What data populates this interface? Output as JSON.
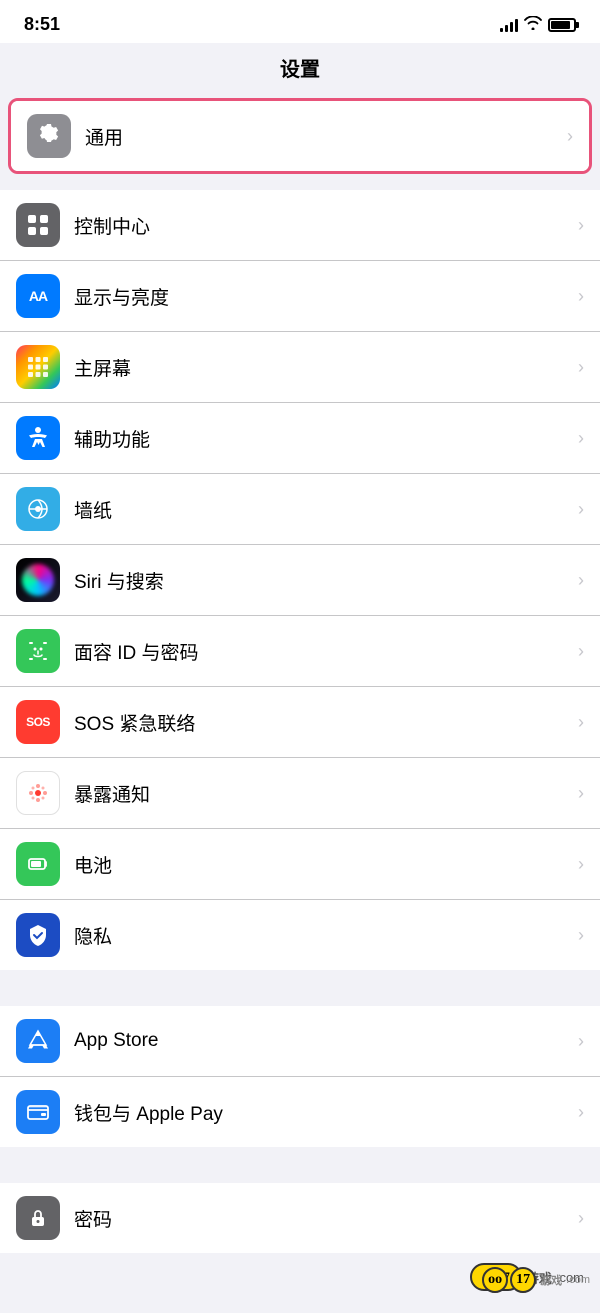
{
  "statusBar": {
    "time": "8:51"
  },
  "header": {
    "title": "设置"
  },
  "sections": [
    {
      "id": "general-highlighted",
      "items": [
        {
          "id": "general",
          "label": "通用",
          "iconType": "gear",
          "iconBg": "icon-gray",
          "highlighted": true
        }
      ]
    },
    {
      "id": "main-settings",
      "items": [
        {
          "id": "control-center",
          "label": "控制中心",
          "iconType": "control",
          "iconBg": "icon-gray-dark"
        },
        {
          "id": "display",
          "label": "显示与亮度",
          "iconType": "display",
          "iconBg": "icon-blue"
        },
        {
          "id": "homescreen",
          "label": "主屏幕",
          "iconType": "homescreen",
          "iconBg": "pink-multi"
        },
        {
          "id": "accessibility",
          "label": "辅助功能",
          "iconType": "accessibility",
          "iconBg": "icon-blue"
        },
        {
          "id": "wallpaper",
          "label": "墙纸",
          "iconType": "wallpaper",
          "iconBg": "icon-teal"
        },
        {
          "id": "siri",
          "label": "Siri 与搜索",
          "iconType": "siri",
          "iconBg": "siri-gradient"
        },
        {
          "id": "faceid",
          "label": "面容 ID 与密码",
          "iconType": "faceid",
          "iconBg": "icon-green"
        },
        {
          "id": "sos",
          "label": "SOS 紧急联络",
          "iconType": "sos",
          "iconBg": "icon-red"
        },
        {
          "id": "exposure",
          "label": "暴露通知",
          "iconType": "exposure",
          "iconBg": "white-dots"
        },
        {
          "id": "battery",
          "label": "电池",
          "iconType": "battery",
          "iconBg": "icon-green"
        },
        {
          "id": "privacy",
          "label": "隐私",
          "iconType": "privacy",
          "iconBg": "icon-indigo"
        }
      ]
    },
    {
      "id": "store-section",
      "items": [
        {
          "id": "appstore",
          "label": "App Store",
          "iconType": "appstore",
          "iconBg": "icon-app-store"
        },
        {
          "id": "wallet",
          "label": "钱包与 Apple Pay",
          "iconType": "wallet",
          "iconBg": "icon-wallet"
        }
      ]
    },
    {
      "id": "password-section",
      "items": [
        {
          "id": "password",
          "label": "密码",
          "iconType": "passwordkey",
          "iconBg": "icon-password"
        }
      ]
    }
  ],
  "chevron": "›"
}
